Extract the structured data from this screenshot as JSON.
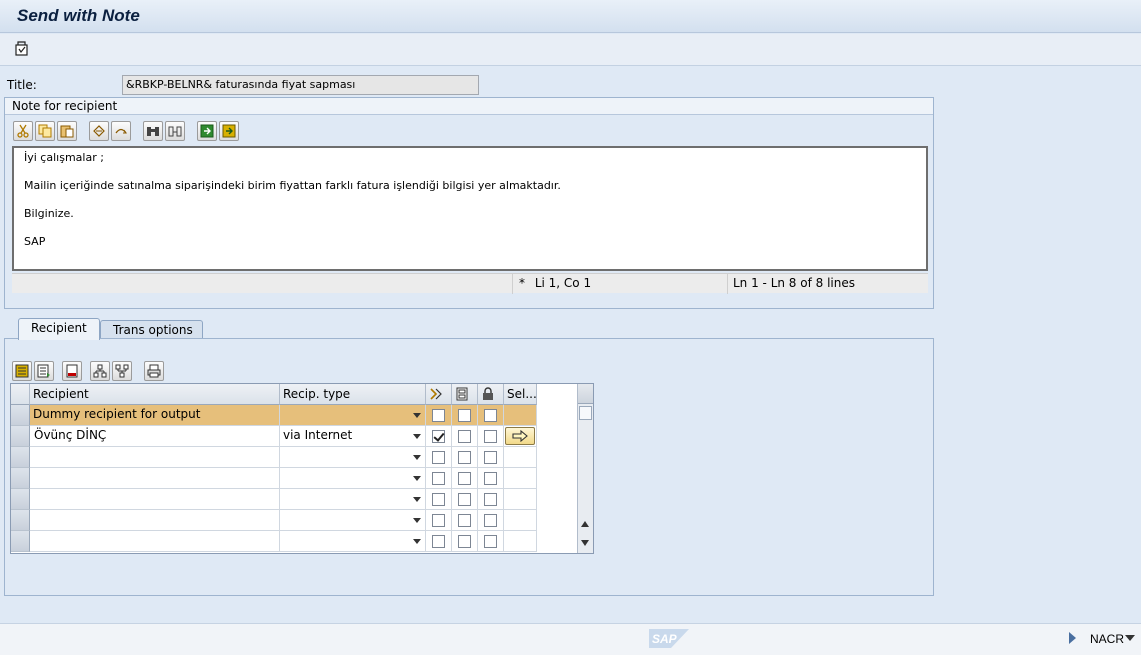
{
  "window": {
    "title": "Send with Note"
  },
  "toolbar": {
    "buttons": [
      {
        "icon": "display-change-icon"
      }
    ]
  },
  "title_field": {
    "label": "Title:",
    "value": "&RBKP-BELNR& faturasında fiyat sapması"
  },
  "note": {
    "heading": "Note for recipient",
    "tools": [
      "cut-icon",
      "copy-icon",
      "paste-icon",
      "undo-icon",
      "redo-icon",
      "find-icon",
      "find-next-icon",
      "load-local-file-icon",
      "save-local-file-icon"
    ],
    "lines": [
      "İyi çalışmalar ;",
      "",
      "Mailin içeriğinde satınalma siparişindeki birim fiyattan farklı fatura işlendiği bilgisi yer almaktadır.",
      "",
      "Bilginize.",
      "",
      "SAP",
      ""
    ],
    "status": {
      "modified": "*",
      "cursor": "Li 1, Co 1",
      "range": "Ln 1 - Ln 8 of 8 lines"
    }
  },
  "tabs": [
    {
      "label": "Recipient",
      "active": true
    },
    {
      "label": "Trans options",
      "active": false
    }
  ],
  "recipient_table": {
    "tools": [
      "insert-row-icon",
      "append-row-icon",
      "delete-row-icon",
      "expand-icon",
      "collapse-icon",
      "print-icon"
    ],
    "columns": [
      "Recipient",
      "Recip. type",
      "",
      "",
      "",
      "Sel..."
    ],
    "column_icons": [
      "express-icon",
      "copy-icon",
      "blind-copy-icon"
    ],
    "rows": [
      {
        "recipient": "Dummy recipient for output",
        "type": "",
        "c1": false,
        "c2": false,
        "c3": false,
        "highlighted": true,
        "sel_button": false
      },
      {
        "recipient": " Övünç DİNÇ",
        "type": "via Internet",
        "c1": true,
        "c2": false,
        "c3": false,
        "highlighted": false,
        "sel_button": true
      },
      {
        "recipient": "",
        "type": "",
        "c1": false,
        "c2": false,
        "c3": false,
        "highlighted": false,
        "sel_button": false
      },
      {
        "recipient": "",
        "type": "",
        "c1": false,
        "c2": false,
        "c3": false,
        "highlighted": false,
        "sel_button": false
      },
      {
        "recipient": "",
        "type": "",
        "c1": false,
        "c2": false,
        "c3": false,
        "highlighted": false,
        "sel_button": false
      },
      {
        "recipient": "",
        "type": "",
        "c1": false,
        "c2": false,
        "c3": false,
        "highlighted": false,
        "sel_button": false
      },
      {
        "recipient": "",
        "type": "",
        "c1": false,
        "c2": false,
        "c3": false,
        "highlighted": false,
        "sel_button": false
      }
    ]
  },
  "footer": {
    "logo_text": "SAP",
    "system": "NACR"
  },
  "colors": {
    "highlight_row": "#e6bf7b",
    "background": "#dfe9f5"
  }
}
